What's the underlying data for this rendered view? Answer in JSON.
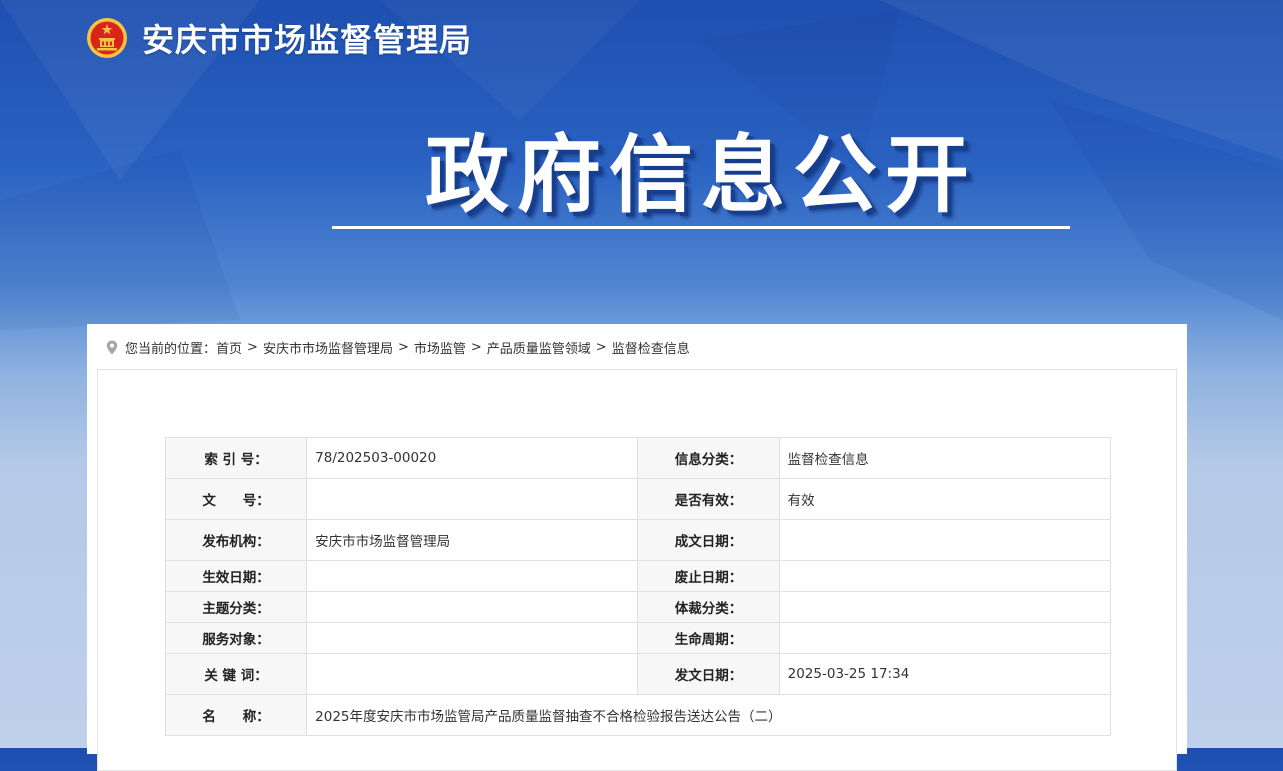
{
  "site": {
    "title": "安庆市市场监督管理局"
  },
  "banner": {
    "title": "政府信息公开"
  },
  "breadcrumb": {
    "prefix": "您当前的位置：",
    "items": [
      "首页",
      "安庆市市场监督管理局",
      "市场监管",
      "产品质量监管领域",
      "监督检查信息"
    ],
    "separator": ">"
  },
  "info": {
    "index_label": "索 引 号：",
    "index_value": "78/202503-00020",
    "category_label": "信息分类：",
    "category_value": "监督检查信息",
    "docno_label": "文　　号：",
    "docno_value": "",
    "valid_label": "是否有效：",
    "valid_value": "有效",
    "publisher_label": "发布机构：",
    "publisher_value": "安庆市市场监督管理局",
    "created_label": "成文日期：",
    "created_value": "",
    "effective_label": "生效日期：",
    "effective_value": "",
    "expiry_label": "废止日期：",
    "expiry_value": "",
    "topic_label": "主题分类：",
    "topic_value": "",
    "genre_label": "体裁分类：",
    "genre_value": "",
    "audience_label": "服务对象：",
    "audience_value": "",
    "lifecycle_label": "生命周期：",
    "lifecycle_value": "",
    "keywords_label": "关 键 词：",
    "keywords_value": "",
    "pubdate_label": "发文日期：",
    "pubdate_value": "2025-03-25 17:34",
    "name_label": "名　　称：",
    "name_value": "2025年度安庆市市场监管局产品质量监督抽查不合格检验报告送达公告（二）"
  },
  "colors": {
    "accent": "#1d4fb0",
    "emblem_red": "#d9231b",
    "emblem_gold": "#f5c542"
  },
  "icons": {
    "emblem": "national-emblem-icon",
    "location": "location-pin-icon"
  }
}
